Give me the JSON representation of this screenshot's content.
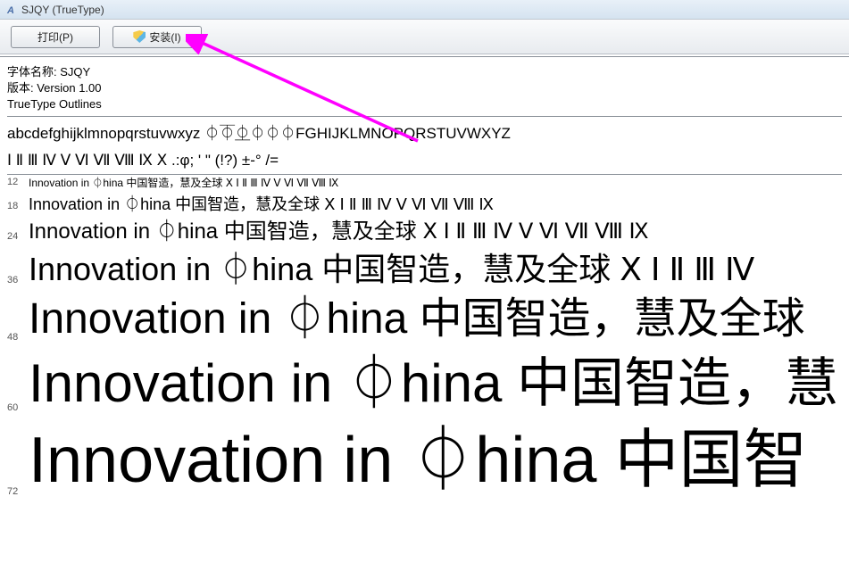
{
  "window": {
    "title": "SJQY (TrueType)"
  },
  "toolbar": {
    "print_label": "打印(P)",
    "install_label": "安装(I)"
  },
  "meta": {
    "font_name_label": "字体名称: SJQY",
    "version_label": "版本: Version 1.00",
    "outlines_label": "TrueType Outlines"
  },
  "charset": {
    "line1": "abcdefghijklmnopqrstuvwxyz ⏀⏁⏂⏀⏀⏀FGHIJKLMNOPQRSTUVWXYZ",
    "line2": "Ⅰ Ⅱ Ⅲ Ⅳ Ⅴ Ⅵ Ⅶ Ⅷ Ⅸ Ⅹ .:φ; ' \" (!?) ±-° /="
  },
  "samples": [
    {
      "size": 12,
      "text": "Innovation in ⏀hina 中国智造，慧及全球 Ⅹ Ⅰ Ⅱ Ⅲ Ⅳ Ⅴ Ⅵ Ⅶ Ⅷ Ⅸ"
    },
    {
      "size": 18,
      "text": "Innovation in ⏀hina 中国智造，慧及全球 Ⅹ Ⅰ Ⅱ Ⅲ Ⅳ Ⅴ Ⅵ Ⅶ Ⅷ Ⅸ"
    },
    {
      "size": 24,
      "text": "Innovation in ⏀hina 中国智造，慧及全球 Ⅹ Ⅰ Ⅱ Ⅲ Ⅳ Ⅴ Ⅵ Ⅶ Ⅷ Ⅸ"
    },
    {
      "size": 36,
      "text": "Innovation in ⏀hina 中国智造，慧及全球 Ⅹ Ⅰ Ⅱ Ⅲ Ⅳ"
    },
    {
      "size": 48,
      "text": "Innovation in ⏀hina 中国智造，慧及全球"
    },
    {
      "size": 60,
      "text": "Innovation in ⏀hina 中国智造，慧"
    },
    {
      "size": 72,
      "text": "Innovation in ⏀hina 中国智"
    }
  ],
  "annotation": {
    "arrow_color": "#ff00ff"
  }
}
